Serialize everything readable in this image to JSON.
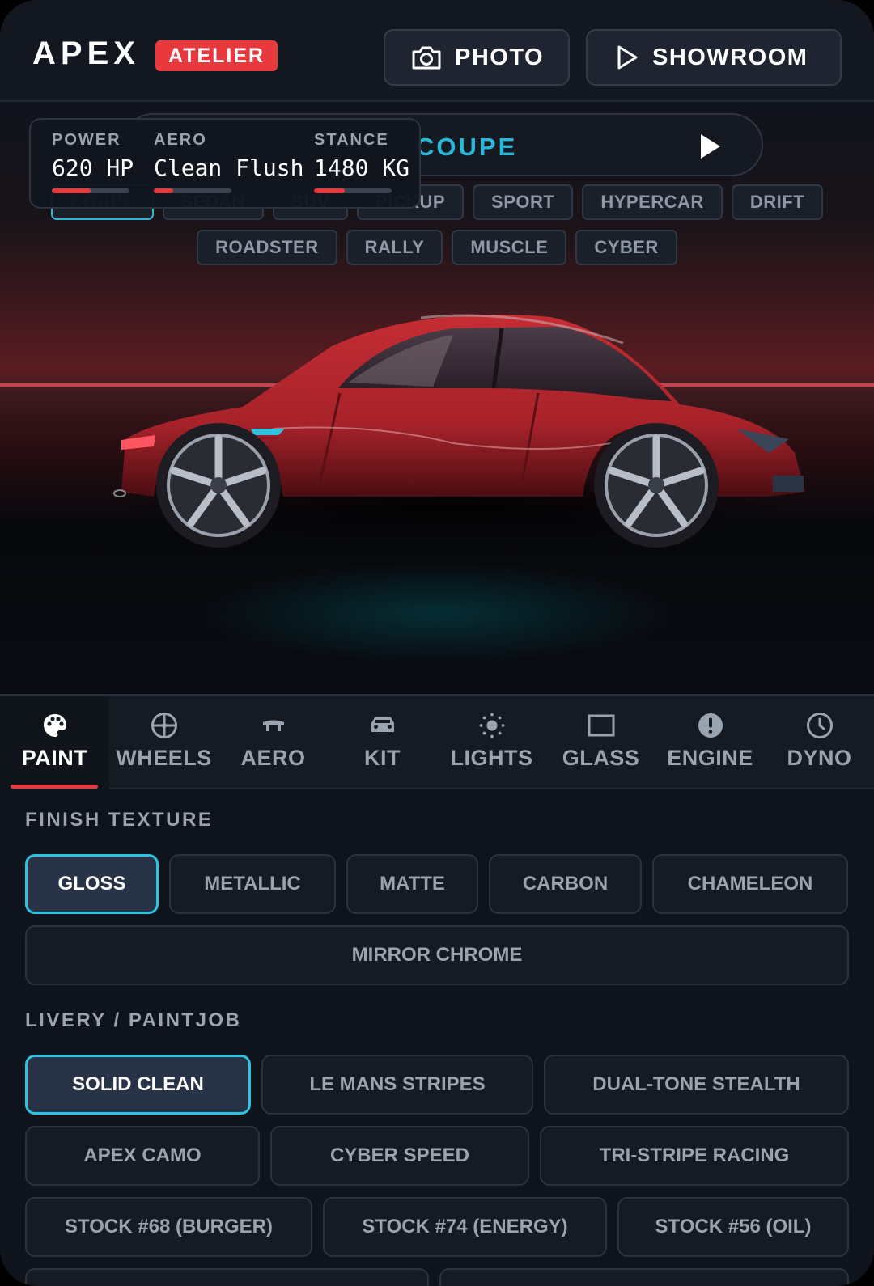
{
  "header": {
    "brand": "APEX",
    "badge": "ATELIER",
    "photo_label": "PHOTO",
    "showroom_label": "SHOWROOM"
  },
  "model_selector": {
    "current": "COUPE",
    "body_types_row1": [
      "COUPE",
      "SEDAN",
      "SUV",
      "PICKUP",
      "SPORT",
      "HYPERCAR",
      "DRIFT"
    ],
    "body_types_row2": [
      "ROADSTER",
      "RALLY",
      "MUSCLE",
      "CYBER"
    ],
    "active": "COUPE"
  },
  "stats": [
    {
      "label": "POWER",
      "value": "620 HP",
      "level": 0.5
    },
    {
      "label": "AERO",
      "value": "Clean Flush",
      "level": 0.25
    },
    {
      "label": "STANCE",
      "value": "1480 KG",
      "level": 0.4
    }
  ],
  "tabs": [
    {
      "label": "PAINT",
      "icon": "palette-icon",
      "active": true
    },
    {
      "label": "WHEELS",
      "icon": "wheel-icon"
    },
    {
      "label": "AERO",
      "icon": "spoiler-icon"
    },
    {
      "label": "KIT",
      "icon": "car-front-icon"
    },
    {
      "label": "LIGHTS",
      "icon": "sun-icon"
    },
    {
      "label": "GLASS",
      "icon": "window-icon"
    },
    {
      "label": "ENGINE",
      "icon": "alert-icon"
    },
    {
      "label": "DYNO",
      "icon": "clock-icon"
    }
  ],
  "finish_texture": {
    "title": "FINISH TEXTURE",
    "options": [
      "GLOSS",
      "METALLIC",
      "MATTE",
      "CARBON",
      "CHAMELEON",
      "MIRROR CHROME"
    ],
    "selected": "GLOSS"
  },
  "livery": {
    "title": "LIVERY / PAINTJOB",
    "options": [
      "SOLID CLEAN",
      "LE MANS STRIPES",
      "DUAL-TONE STEALTH",
      "APEX CAMO",
      "CYBER SPEED",
      "TRI-STRIPE RACING",
      "STOCK #68 (BURGER)",
      "STOCK #74 (ENERGY)",
      "STOCK #56 (OIL)"
    ],
    "selected": "SOLID CLEAN"
  },
  "colors": {
    "accent_red": "#e8393e",
    "accent_cyan": "#29b8d8",
    "car_body": "#b8262c"
  }
}
